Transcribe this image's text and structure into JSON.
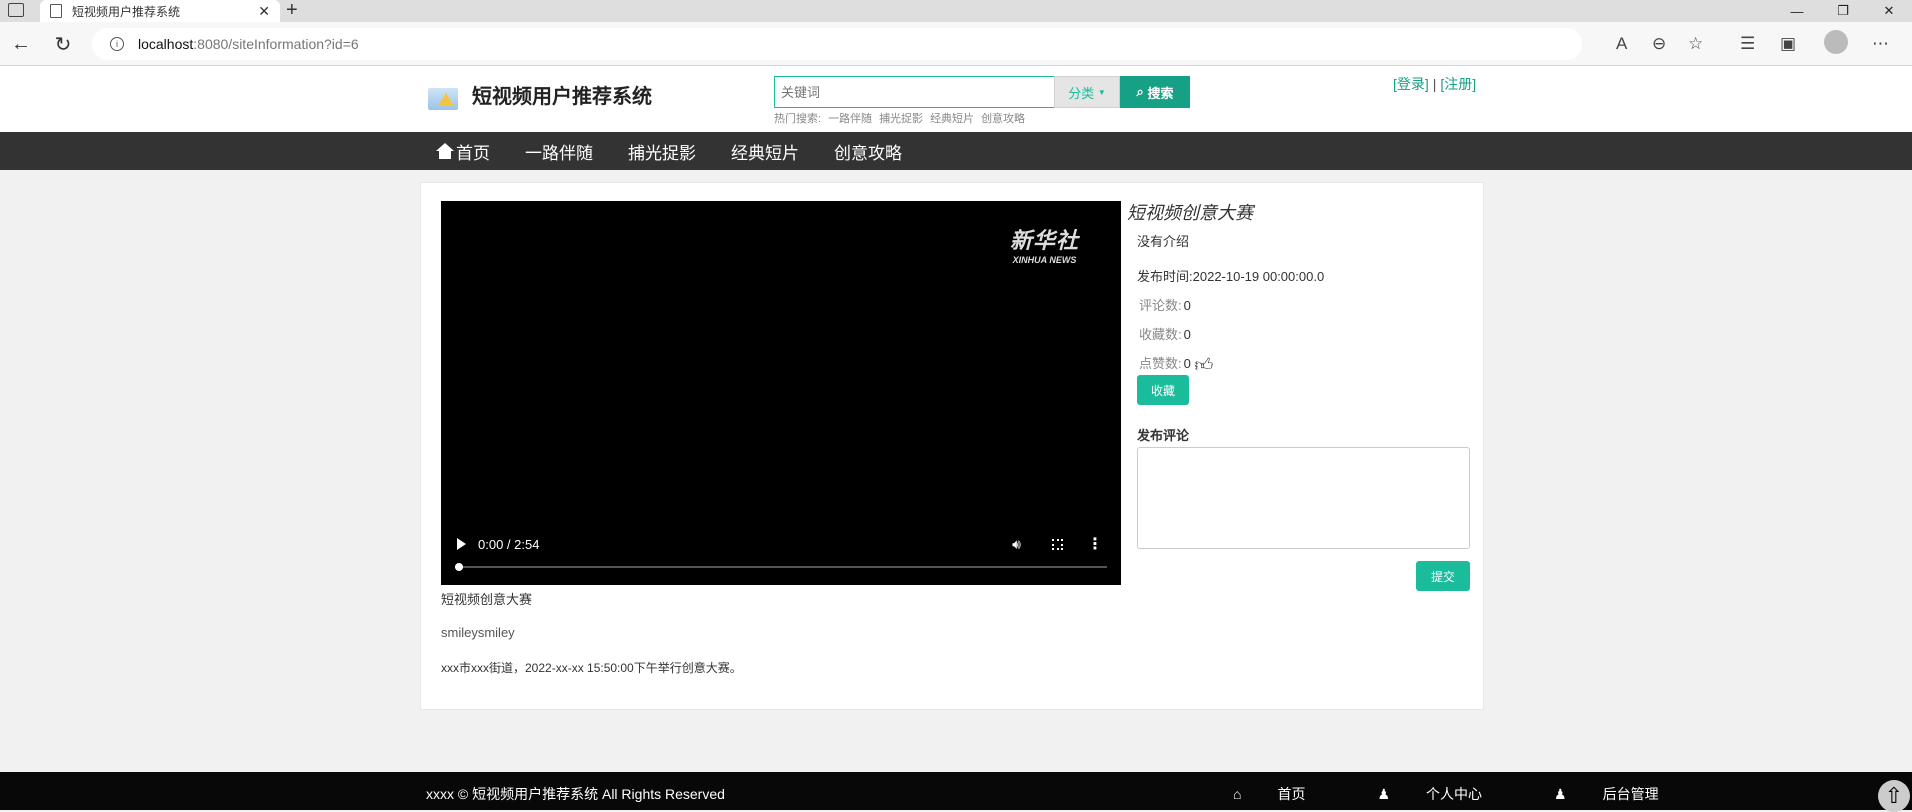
{
  "browser": {
    "tab_title": "短视频用户推荐系统",
    "url_host": "localhost",
    "url_rest": ":8080/siteInformation?id=6"
  },
  "header": {
    "site_title": "短视频用户推荐系统",
    "search_placeholder": "关键词",
    "category_label": "分类",
    "search_label": "搜索",
    "hot_label": "热门搜索:",
    "hot_items": [
      "一路伴随",
      "捕光捉影",
      "经典短片",
      "创意攻略"
    ],
    "login": "[登录]",
    "separator": "|",
    "register": "[注册]"
  },
  "nav": {
    "items": [
      "首页",
      "一路伴随",
      "捕光捉影",
      "经典短片",
      "创意攻略"
    ]
  },
  "video": {
    "watermark_cn": "新华社",
    "watermark_en": "XINHUA NEWS",
    "time": "0:00 / 2:54",
    "progress": 0.0,
    "caption": "短视频创意大赛"
  },
  "content": {
    "smiley_alt": "smiley",
    "description": "xxx市xxx街道，2022-xx-xx 15:50:00下午举行创意大赛。"
  },
  "info": {
    "title": "短视频创意大赛",
    "intro": "没有介绍",
    "date_label": "发布时间:",
    "date_value": "2022-10-19 00:00:00.0",
    "comments_label": "评论数:",
    "comments_value": "0",
    "favorites_label": "收藏数:",
    "favorites_value": "0",
    "likes_label": "点赞数:",
    "likes_value": "0",
    "favorite_button": "收藏",
    "comment_label": "发布评论",
    "submit_button": "提交"
  },
  "footer": {
    "copyright": "xxxx © 短视频用户推荐系统 All Rights Reserved",
    "links": [
      "首页",
      "个人中心",
      "后台管理"
    ]
  },
  "colors": {
    "accent": "#1abc9c",
    "nav_bg": "#333333",
    "footer_bg": "#080808"
  }
}
